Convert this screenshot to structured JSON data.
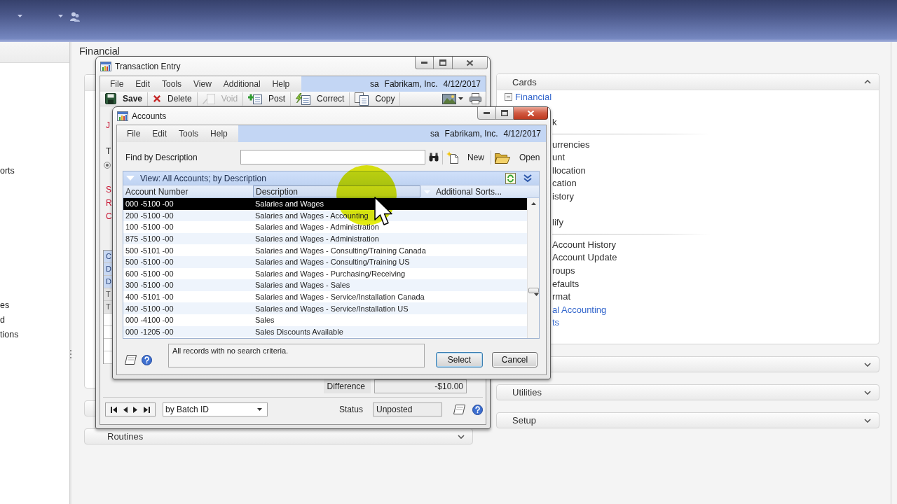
{
  "navigation_pane": {
    "groups": [
      [
        "orts"
      ],
      [
        "es",
        "d",
        "tions"
      ]
    ]
  },
  "workspace": {
    "title": "Financial",
    "left_sections": [
      {
        "expanded": true
      },
      {
        "expanded": false
      },
      {
        "label": "Routines",
        "expanded": false
      }
    ],
    "right_sections": [
      {
        "label": "Cards",
        "expanded": true,
        "categories": [
          {
            "label": "Financial",
            "expanded": true,
            "children": [
              {
                "kind": "item",
                "label": "k"
              },
              {
                "kind": "divider"
              },
              {
                "kind": "item",
                "label": "urrencies"
              },
              {
                "kind": "item",
                "label": "unt"
              },
              {
                "kind": "item",
                "label": "llocation"
              },
              {
                "kind": "item",
                "label": "cation"
              },
              {
                "kind": "item",
                "label": "istory"
              },
              {
                "kind": "item",
                "label": "lify"
              },
              {
                "kind": "divider"
              },
              {
                "kind": "item",
                "label": "Account History"
              },
              {
                "kind": "item",
                "label": "Account Update"
              },
              {
                "kind": "item",
                "label": "roups"
              },
              {
                "kind": "item",
                "label": "efaults"
              },
              {
                "kind": "item",
                "label": "rmat"
              }
            ]
          },
          {
            "label": "al Accounting"
          },
          {
            "label": "ts"
          }
        ]
      },
      {
        "expanded": false
      },
      {
        "label": "Utilities",
        "expanded": false
      },
      {
        "label": "Setup",
        "expanded": false
      }
    ]
  },
  "transaction_entry": {
    "title": "Transaction Entry",
    "menu": [
      "File",
      "Edit",
      "Tools",
      "View",
      "Additional",
      "Help"
    ],
    "user": "sa",
    "company": "Fabrikam, Inc.",
    "date": "4/12/2017",
    "toolbar": [
      {
        "kind": "save",
        "label": "Save",
        "disabled": false
      },
      {
        "kind": "delete",
        "label": "Delete",
        "disabled": false
      },
      {
        "kind": "void",
        "label": "Void",
        "disabled": true
      },
      {
        "kind": "post",
        "label": "Post",
        "disabled": false
      },
      {
        "kind": "correct",
        "label": "Correct",
        "disabled": false
      },
      {
        "kind": "copy",
        "label": "Copy",
        "disabled": false
      }
    ],
    "field_labels": [
      {
        "kind": "label",
        "text": "J",
        "required": true
      },
      {
        "kind": "label",
        "text": "T",
        "required": false
      },
      {
        "kind": "option"
      },
      {
        "kind": "label",
        "text": "S",
        "required": true
      },
      {
        "kind": "label",
        "text": "R",
        "required": true
      },
      {
        "kind": "label",
        "text": "C",
        "required": true
      }
    ],
    "grid_cells": [
      {
        "kind": "header",
        "text": "C"
      },
      {
        "kind": "header",
        "text": "D"
      },
      {
        "kind": "header",
        "text": "D"
      },
      {
        "kind": "row",
        "text": "T"
      },
      {
        "kind": "row",
        "text": "T"
      }
    ],
    "difference_label": "Difference",
    "difference": "-$10.00",
    "browse_by": "by Batch ID",
    "status_label": "Status",
    "status": "Unposted"
  },
  "accounts": {
    "title": "Accounts",
    "menu": [
      "File",
      "Edit",
      "Tools",
      "Help"
    ],
    "user": "sa",
    "company": "Fabrikam, Inc.",
    "date": "4/12/2017",
    "find_label": "Find by Description",
    "actions": [
      {
        "kind": "new",
        "label": "New"
      },
      {
        "kind": "open",
        "label": "Open"
      }
    ],
    "view": "View: All Accounts; by Description",
    "columns": [
      {
        "label": "Account Number",
        "sorted": false
      },
      {
        "label": "Description",
        "sorted": true
      }
    ],
    "additional_sorts": "Additional Sorts...",
    "rows": [
      {
        "account": "000 -5100 -00",
        "description": "Salaries and Wages",
        "selected": true
      },
      {
        "account": "200 -5100 -00",
        "description": "Salaries and Wages - Accounting",
        "selected": false
      },
      {
        "account": "100 -5100 -00",
        "description": "Salaries and Wages - Administration",
        "selected": false
      },
      {
        "account": "875 -5100 -00",
        "description": "Salaries and Wages - Administration",
        "selected": false
      },
      {
        "account": "500 -5101 -00",
        "description": "Salaries and Wages - Consulting/Training Canada",
        "selected": false
      },
      {
        "account": "500 -5100 -00",
        "description": "Salaries and Wages - Consulting/Training US",
        "selected": false
      },
      {
        "account": "600 -5100 -00",
        "description": "Salaries and Wages - Purchasing/Receiving",
        "selected": false
      },
      {
        "account": "300 -5100 -00",
        "description": "Salaries and Wages - Sales",
        "selected": false
      },
      {
        "account": "400 -5101 -00",
        "description": "Salaries and Wages - Service/Installation Canada",
        "selected": false
      },
      {
        "account": "400 -5100 -00",
        "description": "Salaries and Wages - Service/Installation US",
        "selected": false
      },
      {
        "account": "000 -4100 -00",
        "description": "Sales",
        "selected": false
      },
      {
        "account": "000 -1205 -00",
        "description": "Sales Discounts Available",
        "selected": false
      }
    ],
    "status_message": "All records with no search criteria.",
    "buttons": [
      {
        "label": "Select",
        "default": true
      },
      {
        "label": "Cancel",
        "default": false
      }
    ]
  }
}
